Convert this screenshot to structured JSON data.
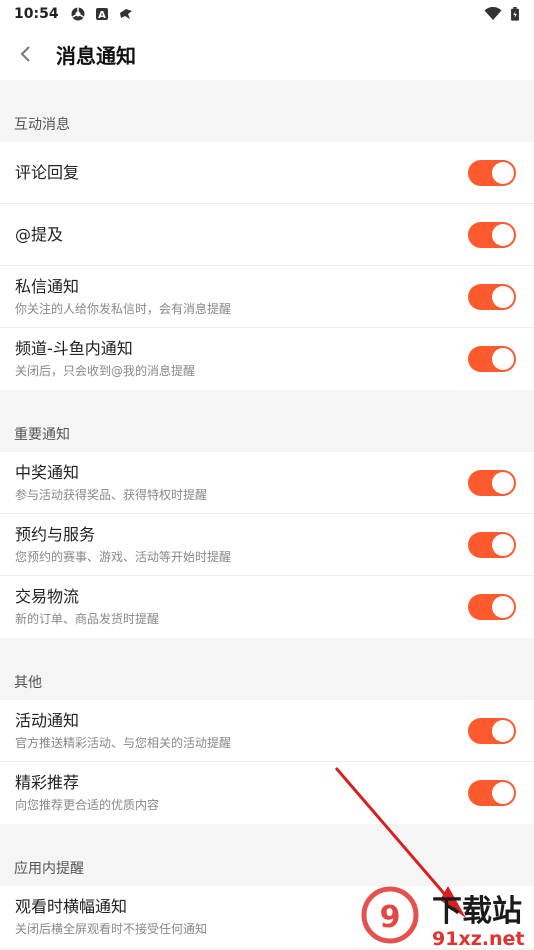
{
  "status_bar": {
    "time": "10:54",
    "left_icons": [
      "chrome-like-icon",
      "a-letter-icon",
      "bird-icon"
    ],
    "right_icons": [
      "wifi-icon",
      "battery-icon"
    ]
  },
  "header": {
    "back_icon": "chevron-left-icon",
    "title": "消息通知"
  },
  "sections": [
    {
      "title": "互动消息",
      "items": [
        {
          "title": "评论回复",
          "desc": "",
          "enabled": true
        },
        {
          "title": "@提及",
          "desc": "",
          "enabled": true
        },
        {
          "title": "私信通知",
          "desc": "你关注的人给你发私信时，会有消息提醒",
          "enabled": true
        },
        {
          "title": "频道-斗鱼内通知",
          "desc": "关闭后，只会收到@我的消息提醒",
          "enabled": true
        }
      ]
    },
    {
      "title": "重要通知",
      "items": [
        {
          "title": "中奖通知",
          "desc": "参与活动获得奖品、获得特权时提醒",
          "enabled": true
        },
        {
          "title": "预约与服务",
          "desc": "您预约的赛事、游戏、活动等开始时提醒",
          "enabled": true
        },
        {
          "title": "交易物流",
          "desc": "新的订单、商品发货时提醒",
          "enabled": true
        }
      ]
    },
    {
      "title": "其他",
      "items": [
        {
          "title": "活动通知",
          "desc": "官方推送精彩活动、与您相关的活动提醒",
          "enabled": true
        },
        {
          "title": "精彩推荐",
          "desc": "向您推荐更合适的优质内容",
          "enabled": true
        }
      ]
    },
    {
      "title": "应用内提醒",
      "items": [
        {
          "title": "观看时横幅通知",
          "desc": "关闭后横全屏观看时不接受任何通知",
          "enabled": null
        }
      ]
    }
  ],
  "watermark": {
    "text_top": "下载站",
    "text_bottom": "91xz.net"
  },
  "colors": {
    "accent": "#ff5a2d",
    "background": "#f5f5f5",
    "arrow": "#d62020"
  }
}
